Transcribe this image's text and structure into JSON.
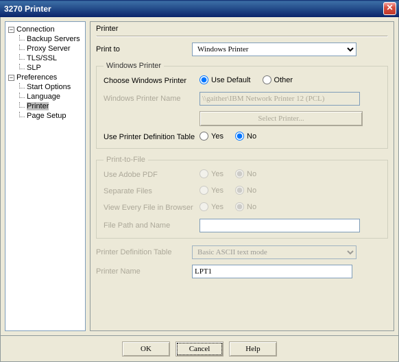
{
  "window": {
    "title": "3270 Printer"
  },
  "tree": {
    "connection": "Connection",
    "backup": "Backup Servers",
    "proxy": "Proxy Server",
    "tls": "TLS/SSL",
    "slp": "SLP",
    "preferences": "Preferences",
    "start": "Start Options",
    "language": "Language",
    "printer": "Printer",
    "pagesetup": "Page Setup"
  },
  "header": {
    "section": "Printer"
  },
  "printto": {
    "label": "Print to",
    "value": "Windows Printer"
  },
  "winprinter": {
    "legend": "Windows Printer",
    "choose": "Choose Windows Printer",
    "usedefault": "Use Default",
    "other": "Other",
    "namelabel": "Windows Printer Name",
    "namevalue": "\\\\gaither\\IBM Network Printer 12 (PCL)",
    "selectbtn": "Select Printer...",
    "pdt": "Use Printer Definition Table",
    "yes": "Yes",
    "no": "No"
  },
  "ptf": {
    "legend": "Print-to-File",
    "adobe": "Use Adobe PDF",
    "sepfiles": "Separate Files",
    "viewbrowser": "View Every File in Browser",
    "filepath": "File Path and Name",
    "yes": "Yes",
    "no": "No"
  },
  "pdtsel": {
    "label": "Printer Definition Table",
    "value": "Basic ASCII text mode"
  },
  "pname": {
    "label": "Printer Name",
    "value": "LPT1"
  },
  "buttons": {
    "ok": "OK",
    "cancel": "Cancel",
    "help": "Help"
  }
}
